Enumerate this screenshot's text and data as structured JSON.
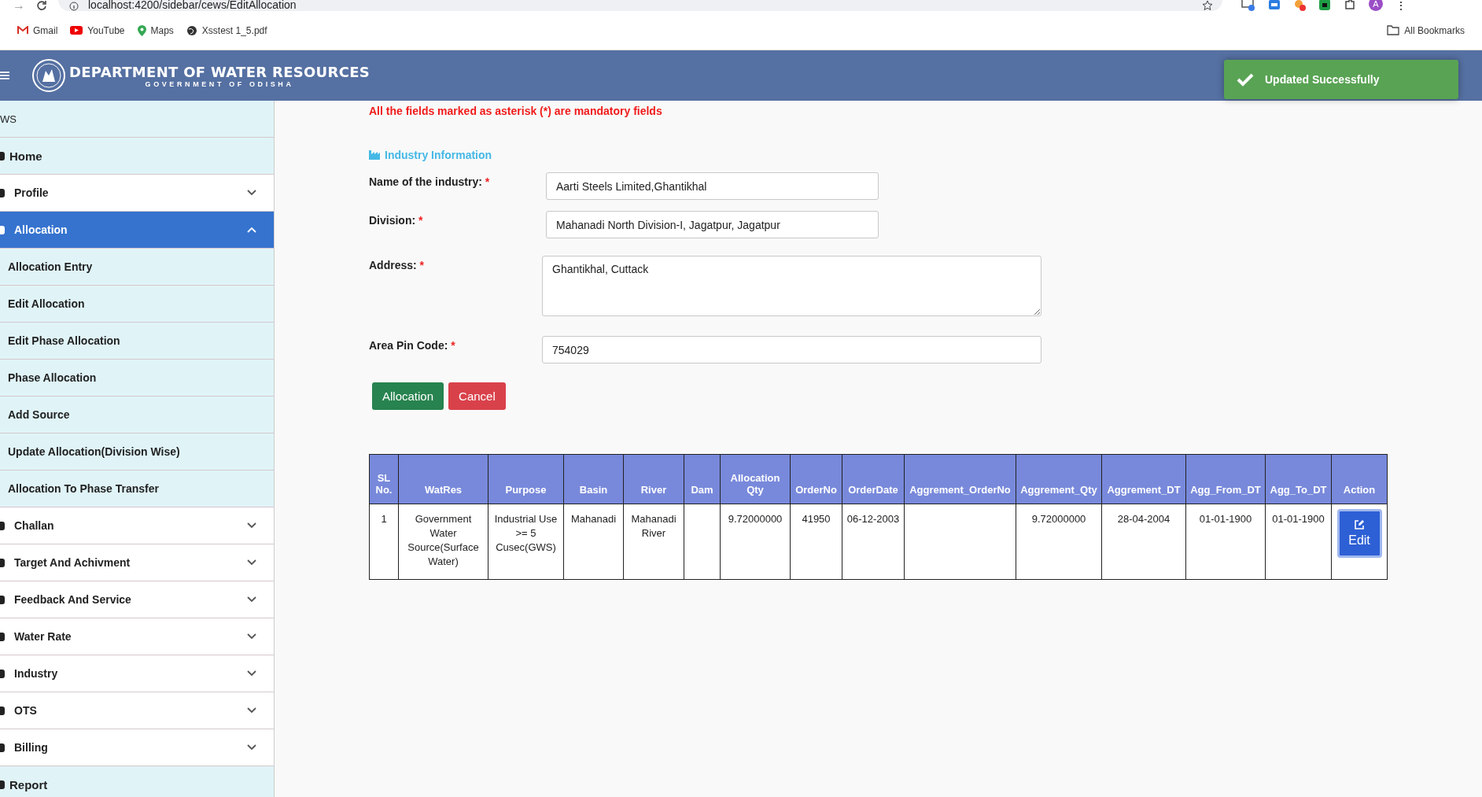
{
  "browser": {
    "forward": "→",
    "more": "⋮",
    "url": "localhost:4200/sidebar/cews/EditAllocation",
    "avatar": "A",
    "bookmarks": [
      {
        "label": "Gmail",
        "kind": "gmail"
      },
      {
        "label": "YouTube",
        "kind": "youtube"
      },
      {
        "label": "Maps",
        "kind": "maps"
      },
      {
        "label": "Xsstest 1_5.pdf",
        "kind": "globe"
      }
    ],
    "all_bookmarks": "All Bookmarks"
  },
  "header": {
    "title": "DEPARTMENT OF WATER RESOURCES",
    "subtitle": "GOVERNMENT OF ODISHA"
  },
  "toast": {
    "message": "Updated Successfully"
  },
  "sidebar": {
    "heading": "WS",
    "items": [
      {
        "label": "Home",
        "kind": "link"
      },
      {
        "label": "Profile",
        "kind": "group",
        "expanded": false,
        "selected": false
      },
      {
        "label": "Allocation",
        "kind": "group",
        "expanded": true,
        "selected": true,
        "children": [
          {
            "label": "Allocation Entry"
          },
          {
            "label": "Edit Allocation"
          },
          {
            "label": "Edit Phase Allocation"
          },
          {
            "label": "Phase Allocation"
          },
          {
            "label": "Add Source"
          },
          {
            "label": "Update Allocation(Division Wise)"
          },
          {
            "label": "Allocation To Phase Transfer"
          }
        ]
      },
      {
        "label": "Challan",
        "kind": "group",
        "expanded": false,
        "selected": false
      },
      {
        "label": "Target And Achivment",
        "kind": "group",
        "expanded": false,
        "selected": false
      },
      {
        "label": "Feedback And Service",
        "kind": "group",
        "expanded": false,
        "selected": false
      },
      {
        "label": "Water Rate",
        "kind": "group",
        "expanded": false,
        "selected": false
      },
      {
        "label": "Industry",
        "kind": "group",
        "expanded": false,
        "selected": false
      },
      {
        "label": "OTS",
        "kind": "group",
        "expanded": false,
        "selected": false
      },
      {
        "label": "Billing",
        "kind": "group",
        "expanded": false,
        "selected": false
      },
      {
        "label": "Report",
        "kind": "link"
      }
    ]
  },
  "form": {
    "notice": "All the fields marked as asterisk (*) are mandatory fields",
    "section_title": "Industry Information",
    "fields": [
      {
        "label": "Name of the industry:",
        "required": "*",
        "value": "Aarti Steels Limited,Ghantikhal",
        "kind": "short"
      },
      {
        "label": "Division:",
        "required": "*",
        "value": "Mahanadi North Division-I, Jagatpur, Jagatpur",
        "kind": "short"
      },
      {
        "label": "Address:",
        "required": "*",
        "value": "Ghantikhal, Cuttack",
        "kind": "textarea"
      },
      {
        "label": "Area Pin Code:",
        "required": "*",
        "value": "754029",
        "kind": "long"
      }
    ],
    "buttons": [
      {
        "label": "Allocation",
        "kind": "primary"
      },
      {
        "label": "Cancel",
        "kind": "danger"
      }
    ]
  },
  "table": {
    "columns": [
      "SL No.",
      "WatRes",
      "Purpose",
      "Basin",
      "River",
      "Dam",
      "Allocation Qty",
      "OrderNo",
      "OrderDate",
      "Aggrement_OrderNo",
      "Aggrement_Qty",
      "Aggrement_DT",
      "Agg_From_DT",
      "Agg_To_DT",
      "Action"
    ],
    "rows": [
      {
        "cells": [
          "1",
          "Government Water Source(Surface Water)",
          "Industrial Use >= 5 Cusec(GWS)",
          "Mahanadi",
          "Mahanadi River",
          "",
          "9.72000000",
          "41950",
          "06-12-2003",
          "",
          "9.72000000",
          "28-04-2004",
          "01-01-1900",
          "01-01-1900"
        ],
        "action": "Edit"
      }
    ]
  }
}
